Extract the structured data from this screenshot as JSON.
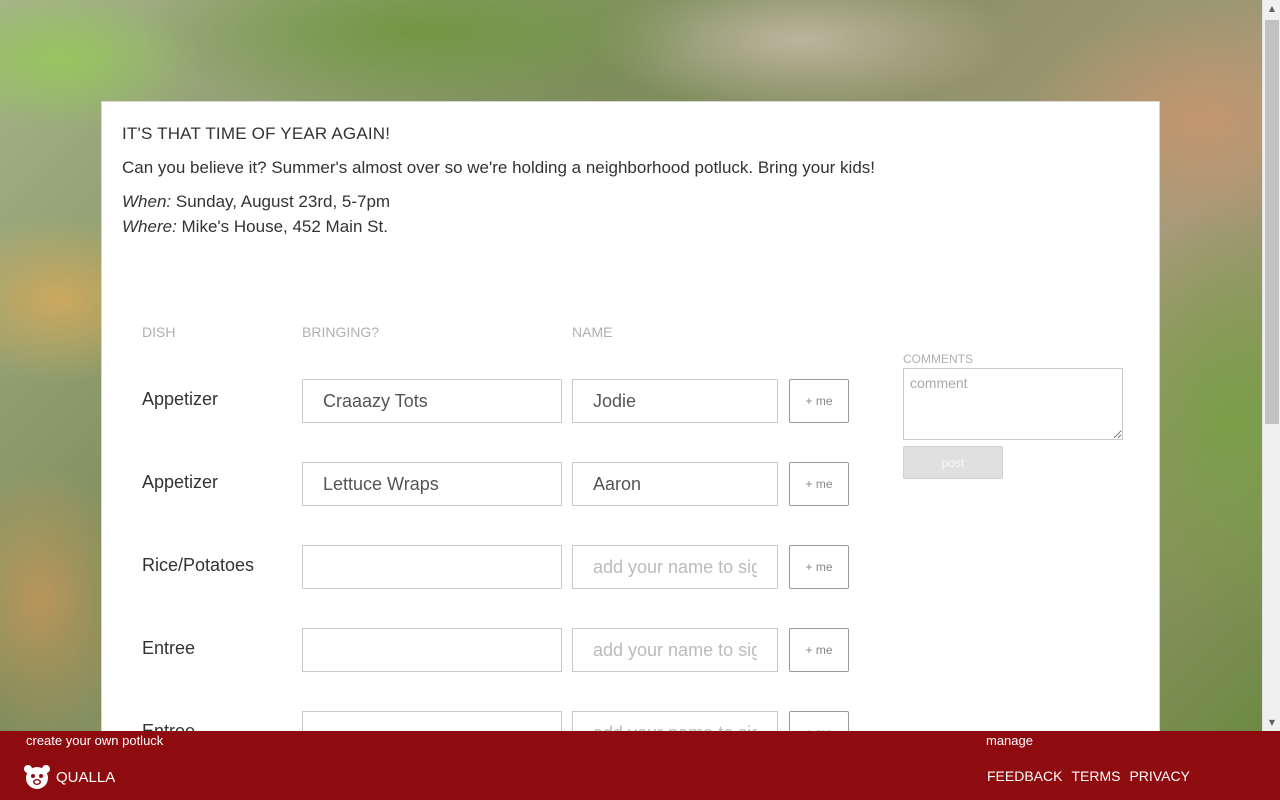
{
  "event": {
    "title": "IT'S THAT TIME OF YEAR AGAIN!",
    "description": "Can you believe it? Summer's almost over so we're holding a neighborhood potluck.  Bring your kids!",
    "when_label": "When:",
    "when_value": " Sunday, August 23rd, 5-7pm",
    "where_label": "Where:",
    "where_value": " Mike's House, 452 Main St."
  },
  "table": {
    "headers": {
      "dish": "DISH",
      "bringing": "BRINGING?",
      "name": "NAME"
    },
    "me_label": "+ me",
    "rows": [
      {
        "dish": "Appetizer",
        "bringing": "Craaazy Tots",
        "name": "Jodie",
        "name_placeholder": ""
      },
      {
        "dish": "Appetizer",
        "bringing": "Lettuce Wraps",
        "name": "Aaron",
        "name_placeholder": ""
      },
      {
        "dish": "Rice/Potatoes",
        "bringing": "",
        "name": "",
        "name_placeholder": "add your name to sign up"
      },
      {
        "dish": "Entree",
        "bringing": "",
        "name": "",
        "name_placeholder": "add your name to sign up"
      },
      {
        "dish": "Entree",
        "bringing": "",
        "name": "",
        "name_placeholder": "add your name to sign up"
      }
    ]
  },
  "comments": {
    "label": "COMMENTS",
    "placeholder": "comment",
    "post_label": "post"
  },
  "footer": {
    "create_link": "create your own potluck",
    "brand": "QUALLA",
    "manage_link": "manage",
    "links": [
      "FEEDBACK",
      "TERMS",
      "PRIVACY"
    ]
  },
  "colors": {
    "footer_bg": "#8e0b0f",
    "header_text": "#b0b0b0"
  }
}
